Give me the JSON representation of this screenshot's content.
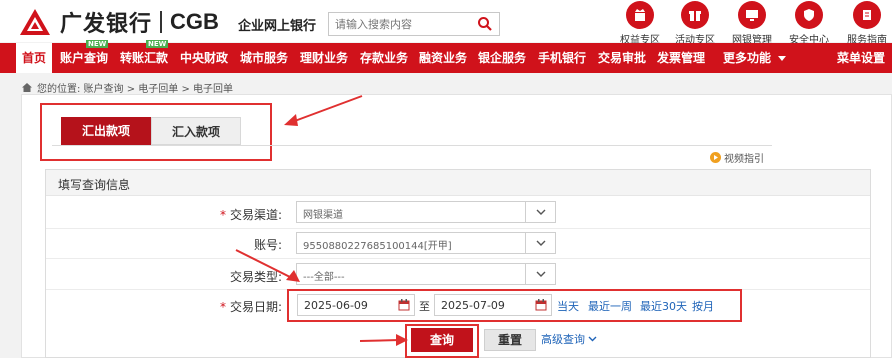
{
  "header": {
    "logo_cn": "广发银行",
    "logo_en": "CGB",
    "subtitle": "企业网上银行",
    "search_placeholder": "请输入搜索内容",
    "quick_links": [
      {
        "label": "权益专区",
        "icon": "gift-crown-icon"
      },
      {
        "label": "活动专区",
        "icon": "gift-box-icon"
      },
      {
        "label": "网银管理",
        "icon": "monitor-icon"
      },
      {
        "label": "安全中心",
        "icon": "shield-icon"
      },
      {
        "label": "服务指南",
        "icon": "book-icon"
      }
    ]
  },
  "nav": {
    "items": [
      "首页",
      "账户查询",
      "转账汇款",
      "中央财政",
      "城市服务",
      "理财业务",
      "存款业务",
      "融资业务",
      "银企服务",
      "手机银行",
      "交易审批",
      "发票管理",
      "更多功能",
      "菜单设置"
    ],
    "active_index": 0,
    "new_badge": "NEW"
  },
  "breadcrumb": "您的位置: 账户查询 > 电子回单 > 电子回单",
  "tabs": {
    "outgoing": "汇出款项",
    "incoming": "汇入款项"
  },
  "video_guide": "视频指引",
  "form": {
    "title": "填写查询信息",
    "channel_label": "交易渠道:",
    "channel_value": "网银渠道",
    "account_label": "账号:",
    "account_value": "9550880227685100144[开甲]",
    "type_label": "交易类型:",
    "type_value": "---全部---",
    "date_label": "交易日期:",
    "date_from": "2025-06-09",
    "date_to": "2025-07-09",
    "to_label": "至",
    "quick_dates": [
      "当天",
      "最近一周",
      "最近30天",
      "按月"
    ],
    "query_button": "查询",
    "reset_button": "重置",
    "advanced_query": "高级查询"
  },
  "colors": {
    "brand_red": "#d0121b",
    "annotation_red": "#e03030",
    "link_blue": "#1e63b8"
  }
}
